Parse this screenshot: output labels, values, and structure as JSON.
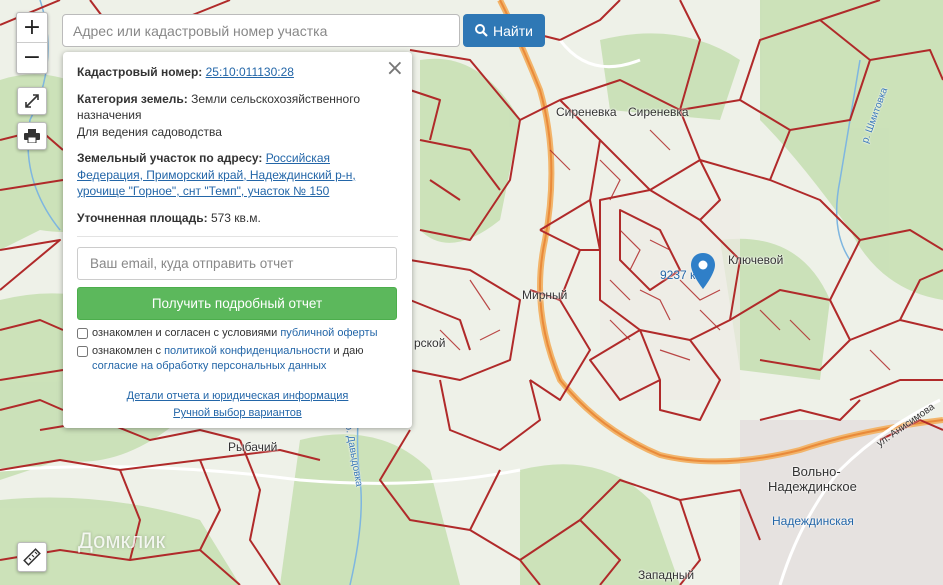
{
  "search": {
    "placeholder": "Адрес или кадастровый номер участка",
    "button_label": "Найти",
    "button_icon": "search-icon"
  },
  "controls": {
    "zoom_in": "+",
    "zoom_out": "−",
    "fullscreen_icon": "expand-icon",
    "print_icon": "print-icon",
    "ruler_icon": "ruler-icon"
  },
  "panel": {
    "cadastral_label": "Кадастровый номер:",
    "cadastral_value": "25:10:011130:28",
    "category_label": "Категория земель:",
    "category_value": "Земли сельскохозяйственного назначения",
    "usage": "Для ведения садоводства",
    "address_label": "Земельный участок по адресу:",
    "address_value": "Российская Федерация, Приморский край, Надеждинский р-н, урочище \"Горное\", снт \"Темп\", участок № 150",
    "area_label": "Уточненная площадь:",
    "area_value": "573 кв.м.",
    "email_placeholder": "Ваш email, куда отправить отчет",
    "report_button": "Получить подробный отчет",
    "consent1_text": "ознакомлен и согласен с условиями ",
    "consent1_link": "публичной оферты",
    "consent2_text": "ознакомлен с ",
    "consent2_link1": "политикой конфиденциальности",
    "consent2_mid": " и даю ",
    "consent2_link2": "согласие на обработку персональных данных",
    "details_link": "Детали отчета и юридическая информация",
    "manual_link": "Ручной выбор вариантов",
    "close": "×"
  },
  "map_labels": {
    "sirenevka1": "Сиреневка",
    "sirenevka2": "Сиреневка",
    "klyuchevoy": "Ключевой",
    "mirny": "Мирный",
    "plot_num": "9237 к",
    "rybachiy": "Рыбачий",
    "volno": "Вольно-",
    "nadezhdinskoe": "Надеждинское",
    "nadezhdinskaya": "Надеждинская",
    "zapadny": "Западный",
    "shmitovka": "р. Шмитовка",
    "davydovka": "р. Давыдовка",
    "anisimova": "ул. Анисимова",
    "lskoy": "рской",
    "watermark": "Домклик"
  },
  "colors": {
    "parcel_border": "#b02a2a",
    "road": "#f0a050",
    "forest": "#c5dfb0",
    "button_blue": "#2f78b5",
    "button_green": "#5cb85c",
    "marker": "#2f7fc8"
  }
}
